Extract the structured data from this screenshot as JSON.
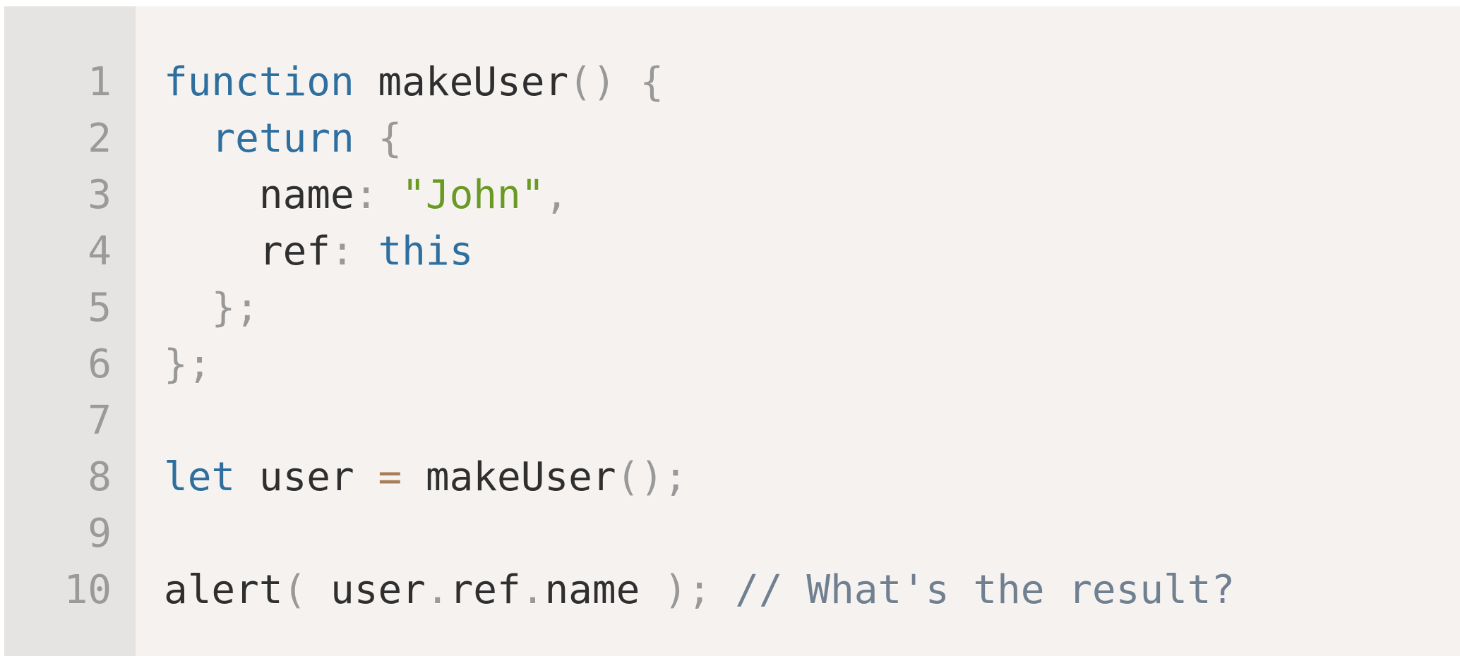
{
  "editor": {
    "line_numbers": [
      "1",
      "2",
      "3",
      "4",
      "5",
      "6",
      "7",
      "8",
      "9",
      "10"
    ],
    "colors": {
      "background": "#f5f2f0",
      "gutter": "#e6e4e2",
      "keyword": "#2f6f9e",
      "string": "#6a9a24",
      "operator": "#a67f59",
      "comment": "#708090",
      "punctuation": "#999999"
    },
    "lines": [
      [
        {
          "type": "keyword",
          "text": "function"
        },
        {
          "type": "plain",
          "text": " makeUser"
        },
        {
          "type": "punct",
          "text": "()"
        },
        {
          "type": "plain",
          "text": " "
        },
        {
          "type": "punct",
          "text": "{"
        }
      ],
      [
        {
          "type": "plain",
          "text": "  "
        },
        {
          "type": "keyword",
          "text": "return"
        },
        {
          "type": "plain",
          "text": " "
        },
        {
          "type": "punct",
          "text": "{"
        }
      ],
      [
        {
          "type": "plain",
          "text": "    name"
        },
        {
          "type": "punct",
          "text": ":"
        },
        {
          "type": "plain",
          "text": " "
        },
        {
          "type": "string",
          "text": "\"John\""
        },
        {
          "type": "punct",
          "text": ","
        }
      ],
      [
        {
          "type": "plain",
          "text": "    ref"
        },
        {
          "type": "punct",
          "text": ":"
        },
        {
          "type": "plain",
          "text": " "
        },
        {
          "type": "keyword",
          "text": "this"
        }
      ],
      [
        {
          "type": "plain",
          "text": "  "
        },
        {
          "type": "punct",
          "text": "};"
        }
      ],
      [
        {
          "type": "punct",
          "text": "};"
        }
      ],
      [],
      [
        {
          "type": "keyword",
          "text": "let"
        },
        {
          "type": "plain",
          "text": " user "
        },
        {
          "type": "operator",
          "text": "="
        },
        {
          "type": "plain",
          "text": " makeUser"
        },
        {
          "type": "punct",
          "text": "();"
        }
      ],
      [],
      [
        {
          "type": "plain",
          "text": "alert"
        },
        {
          "type": "punct",
          "text": "("
        },
        {
          "type": "plain",
          "text": " user"
        },
        {
          "type": "punct",
          "text": "."
        },
        {
          "type": "plain",
          "text": "ref"
        },
        {
          "type": "punct",
          "text": "."
        },
        {
          "type": "plain",
          "text": "name "
        },
        {
          "type": "punct",
          "text": ");"
        },
        {
          "type": "plain",
          "text": " "
        },
        {
          "type": "comment",
          "text": "// What's the result?"
        }
      ]
    ]
  }
}
